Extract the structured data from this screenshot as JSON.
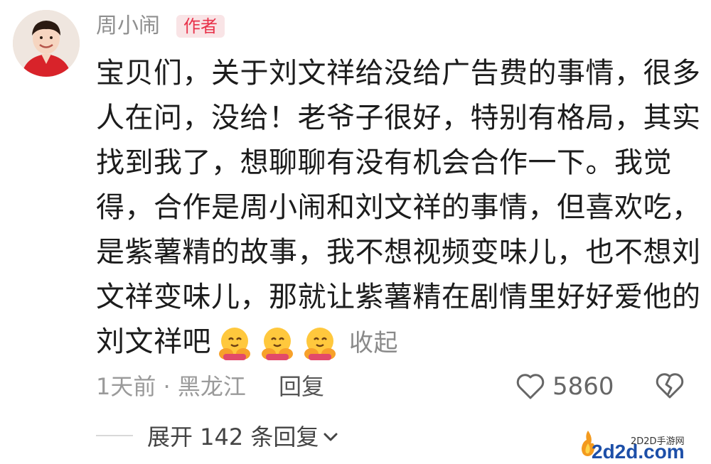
{
  "comment": {
    "username": "周小闹",
    "badge": "作者",
    "lines": [
      "宝贝们，关于刘文祥给没给广告费的事情，很多",
      "人在问，没给！老爷子很好，特别有格局，其实",
      "找到我了，想聊聊有没有机会合作一下。我觉",
      "得，合作是周小闹和刘文祥的事情，但喜欢吃，",
      "是紫薯精的故事，我不想视频变味儿，也不想刘",
      "文祥变味儿，那就让紫薯精在剧情里好好爱他的",
      "刘文祥吧"
    ],
    "emojis": [
      "hugging-face",
      "hugging-face",
      "hugging-face"
    ],
    "collapse_label": "收起",
    "meta": "1天前 · 黑龙江",
    "reply_label": "回复",
    "like_count": "5860"
  },
  "replies": {
    "expand_label": "展开 142 条回复"
  },
  "watermark": {
    "site_label": "2D2D手游网",
    "domain": "2d2d.com"
  },
  "colors": {
    "badge_bg": "#f9e4e6",
    "badge_text": "#e8324a",
    "body_text": "#1c1c1c",
    "muted_text": "#9a9a9a"
  }
}
